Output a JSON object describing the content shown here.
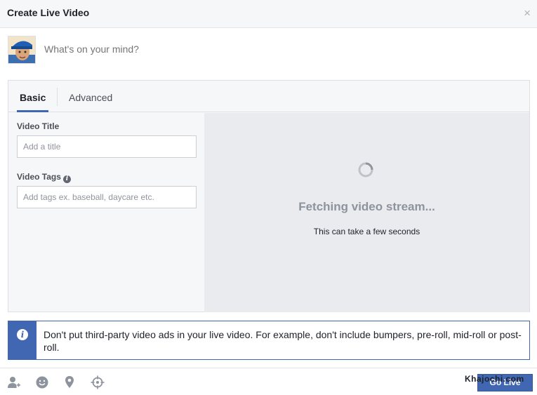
{
  "dialog": {
    "title": "Create Live Video",
    "close_label": "×"
  },
  "composer": {
    "placeholder": "What's on your mind?"
  },
  "tabs": [
    {
      "label": "Basic",
      "active": true
    },
    {
      "label": "Advanced",
      "active": false
    }
  ],
  "form": {
    "title_label": "Video Title",
    "title_placeholder": "Add a title",
    "tags_label": "Video Tags",
    "tags_placeholder": "Add tags ex. baseball, daycare etc."
  },
  "stream": {
    "status_title": "Fetching video stream...",
    "status_subtitle": "This can take a few seconds"
  },
  "notice": {
    "text": "Don't put third-party video ads in your live video. For example, don't include bumpers, pre-roll, mid-roll or post-roll."
  },
  "footer": {
    "icons": [
      "tag-people-icon",
      "feeling-icon",
      "location-icon",
      "target-icon"
    ],
    "go_live_label": "Go Live",
    "watermark": "Khajochi.com"
  },
  "colors": {
    "accent": "#4267b2",
    "header_bg": "#f6f7f9",
    "stream_bg": "#e9ebee",
    "muted_text": "#90949c"
  }
}
